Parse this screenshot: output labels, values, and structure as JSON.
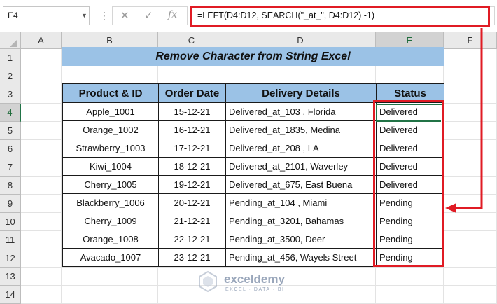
{
  "name_box": {
    "value": "E4"
  },
  "formula_bar": {
    "formula": "=LEFT(D4:D12, SEARCH(\"_at_\", D4:D12) -1)",
    "cancel_icon": "close-icon",
    "enter_icon": "check-icon",
    "fx_label": "fx"
  },
  "grid": {
    "columns": [
      "A",
      "B",
      "C",
      "D",
      "E",
      "F"
    ],
    "rows": [
      "1",
      "2",
      "3",
      "4",
      "5",
      "6",
      "7",
      "8",
      "9",
      "10",
      "11",
      "12",
      "13",
      "14"
    ],
    "selected_column": "E",
    "selected_row": "4"
  },
  "sheet": {
    "title": "Remove Character from String Excel",
    "headers": [
      "Product & ID",
      "Order Date",
      "Delivery Details",
      "Status"
    ],
    "rows": [
      [
        "Apple_1001",
        "15-12-21",
        "Delivered_at_103 , Florida",
        "Delivered"
      ],
      [
        "Orange_1002",
        "16-12-21",
        "Delivered_at_1835, Medina",
        "Delivered"
      ],
      [
        "Strawberry_1003",
        "17-12-21",
        "Delivered_at_208 , LA",
        "Delivered"
      ],
      [
        "Kiwi_1004",
        "18-12-21",
        "Delivered_at_2101, Waverley",
        "Delivered"
      ],
      [
        "Cherry_1005",
        "19-12-21",
        "Delivered_at_675, East Buena",
        "Delivered"
      ],
      [
        "Blackberry_1006",
        "20-12-21",
        "Pending_at_104 , Miami",
        "Pending"
      ],
      [
        "Cherry_1009",
        "21-12-21",
        "Pending_at_3201, Bahamas",
        "Pending"
      ],
      [
        "Orange_1008",
        "22-12-21",
        "Pending_at_3500, Deer",
        "Pending"
      ],
      [
        "Avacado_1007",
        "23-12-21",
        "Pending_at_456, Wayels Street",
        "Pending"
      ]
    ]
  },
  "watermark": {
    "name": "exceldemy",
    "tagline": "EXCEL · DATA · BI"
  },
  "colors": {
    "header_fill": "#9bc2e6",
    "highlight_red": "#e01b24",
    "excel_green": "#217346"
  }
}
